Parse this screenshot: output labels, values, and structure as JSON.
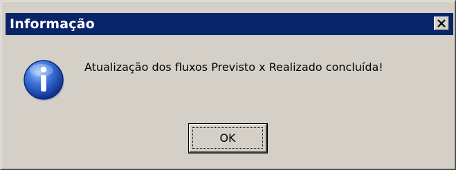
{
  "window": {
    "title": "Informação",
    "close_icon": "close-icon"
  },
  "message": {
    "icon": "info-icon",
    "text": "Atualização dos fluxos Previsto x Realizado concluída!"
  },
  "buttons": {
    "ok_label": "OK"
  },
  "colors": {
    "title_bar": "#0a246a",
    "dialog_face": "#d4d0c8",
    "icon_blue": "#1f4fb8"
  }
}
